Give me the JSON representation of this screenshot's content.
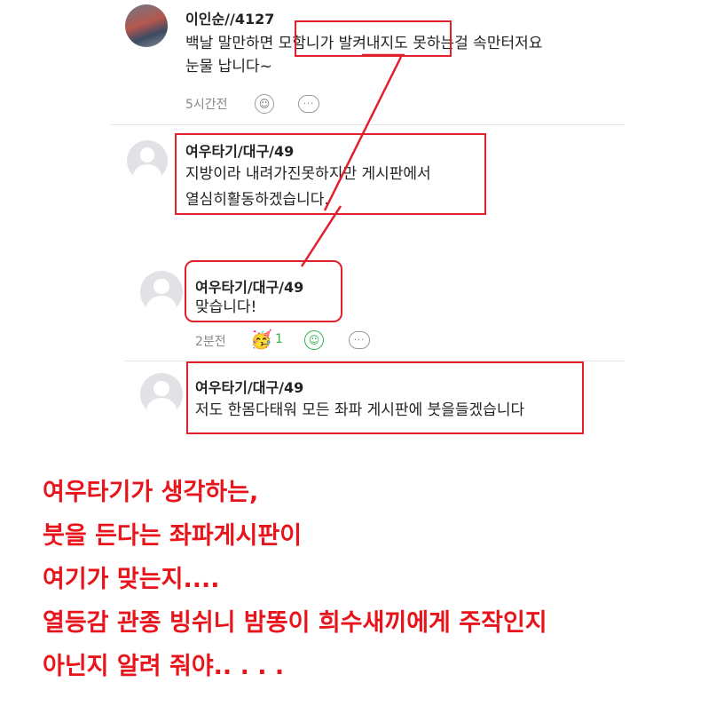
{
  "comment1": {
    "author": "이인순//4127",
    "line1": "백날  말만하면 모함니가 발켜내지도 못하는걸 속만터저요",
    "line2": "눈물 납니다~",
    "time": "5시간전",
    "icon_emoji": "smile-icon",
    "icon_reply": "speech-bubble-icon"
  },
  "reply1": {
    "author": "여우타기/대구/49",
    "line1": "지방이라 내려가진못하지만 게시판에서",
    "line2": "열심히활동하겠습니다."
  },
  "reply2": {
    "author": "여우타기/대구/49",
    "line1": "맞습니다!",
    "time": "2분전",
    "reaction_count": "1",
    "icon_reaction": "reaction-face-icon",
    "icon_emoji": "smile-icon",
    "icon_reply": "speech-bubble-icon"
  },
  "reply3": {
    "author": "여우타기/대구/49",
    "line1": "저도 한몸다태워 모든 좌파 게시판에 붓을들겠습니다"
  },
  "caption": {
    "line1": "여우타기가 생각하는,",
    "line2": "붓을 든다는 좌파게시판이",
    "line3": "여기가 맞는지....",
    "line4": "열등감 관종 빙쉬니 밤똥이 희수새끼에게 주작인지",
    "line5": "아닌지 알려 줘야.. . . ."
  },
  "colors": {
    "annotation_red": "#e0202a",
    "caption_red": "#e8141b",
    "accent_green": "#2bb34a"
  }
}
